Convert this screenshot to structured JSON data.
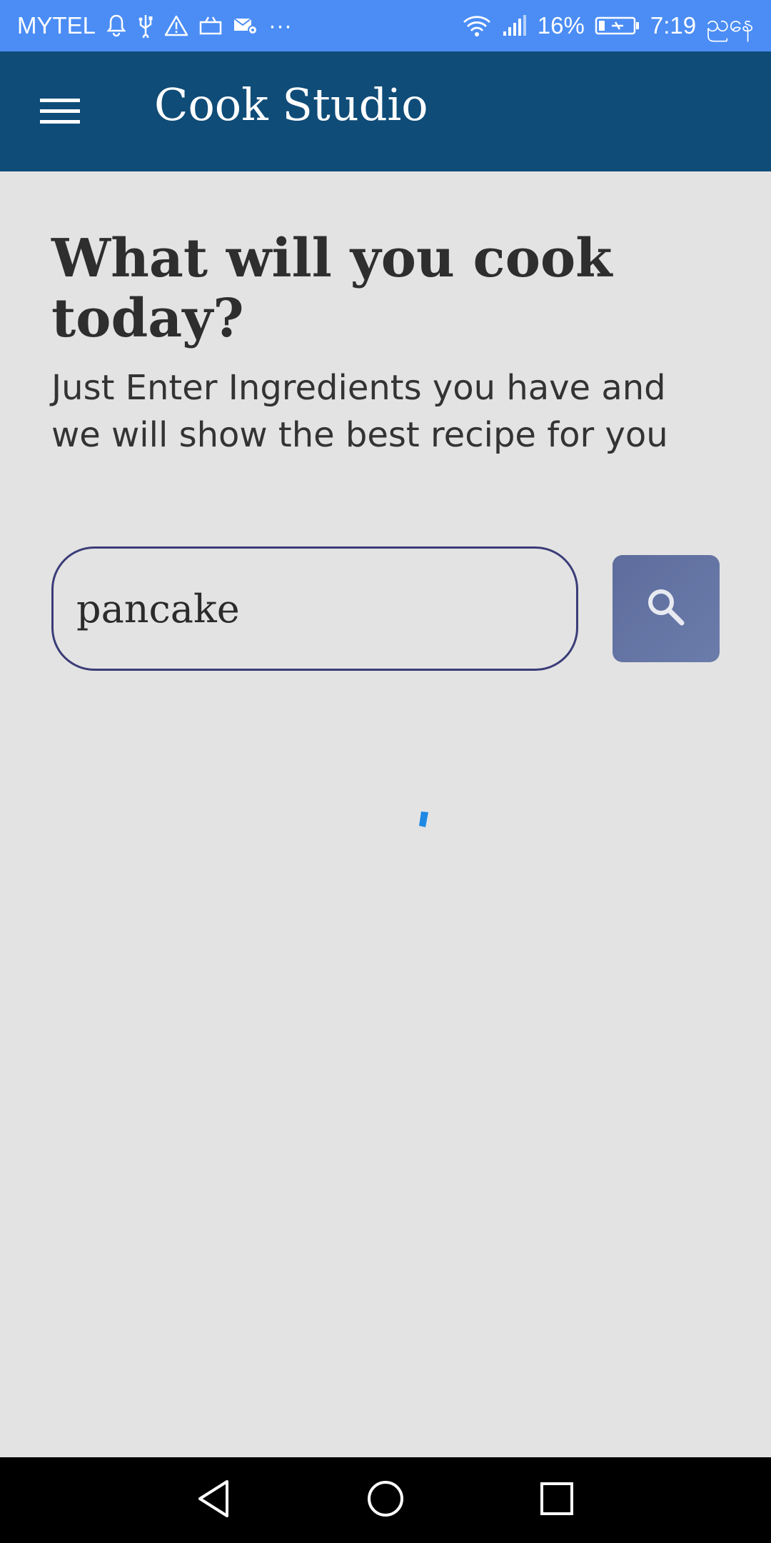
{
  "status_bar": {
    "carrier": "MYTEL",
    "more_indicator": "···",
    "battery_percent": "16%",
    "time": "7:19",
    "period": "ညနေ",
    "left_icons": [
      "bell-icon",
      "usb-icon",
      "warning-icon",
      "cast-icon",
      "mail-settings-icon"
    ],
    "right_icons": [
      "wifi-icon",
      "signal-icon",
      "battery-charging-icon"
    ],
    "background_color": "#4b8df5"
  },
  "app_bar": {
    "title": "Cook Studio",
    "menu_icon": "hamburger-menu-icon",
    "background_color": "#0f4c78"
  },
  "main": {
    "headline": "What will you cook today?",
    "subtext": "Just Enter Ingredients you have and we will show the best recipe for you",
    "search": {
      "value": "pancake",
      "button_icon": "search-icon"
    },
    "loading_indicator_color": "#1e88e5"
  },
  "nav_bar": {
    "buttons": [
      "back-icon",
      "home-icon",
      "recents-icon"
    ]
  }
}
